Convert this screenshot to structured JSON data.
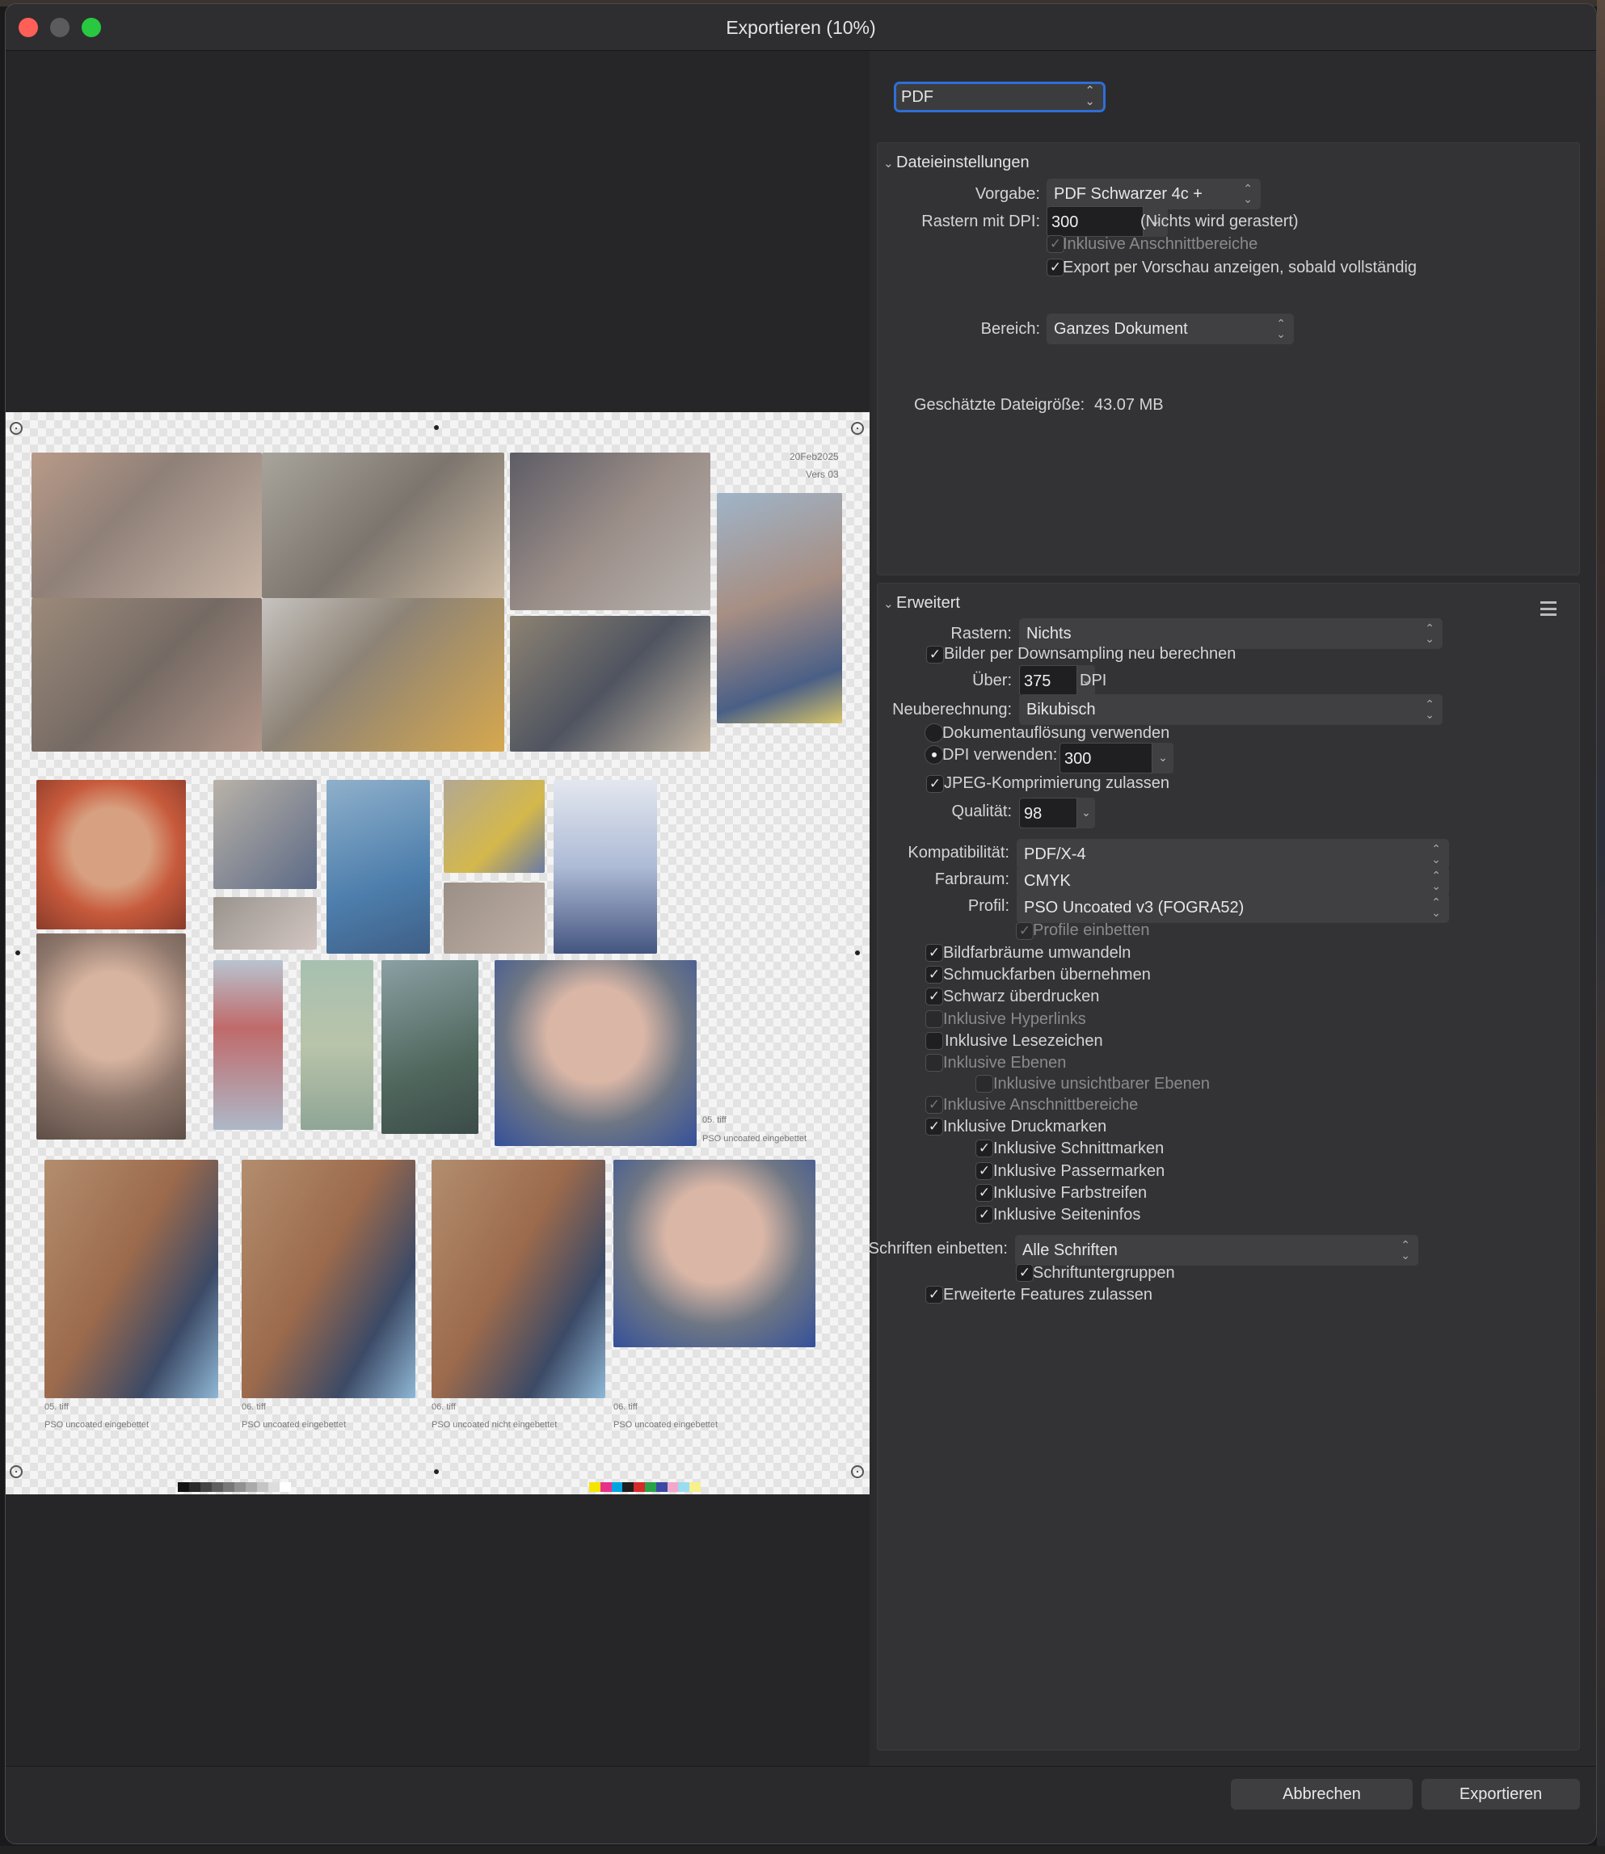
{
  "window": {
    "title": "Exportieren (10%)"
  },
  "format": {
    "selected": "PDF"
  },
  "preview": {
    "date": "20Feb2025",
    "version": "Vers 03",
    "captions": [
      "05. tiff",
      "PSO uncoated eingebettet",
      "05. tiff",
      "PSO uncoated eingebettet",
      "06. tiff",
      "PSO uncoated eingebettet",
      "06. tiff",
      "PSO uncoated nicht eingebettet",
      "06. tiff",
      "PSO uncoated eingebettet"
    ]
  },
  "file_settings": {
    "title": "Dateieinstellungen",
    "preset_label": "Vorgabe:",
    "preset_value": "PDF Schwarzer 4c +",
    "raster_dpi_label": "Rastern mit DPI:",
    "raster_dpi_value": "300",
    "raster_note": "(Nichts wird gerastert)",
    "include_bleed": "Inklusive Anschnittbereiche",
    "preview_after": "Export per Vorschau anzeigen, sobald vollständig",
    "area_label": "Bereich:",
    "area_value": "Ganzes Dokument",
    "size_label": "Geschätzte Dateigröße:",
    "size_value": "43.07 MB"
  },
  "advanced": {
    "title": "Erweitert",
    "raster_label": "Rastern:",
    "raster_value": "Nichts",
    "downsample": "Bilder per Downsampling neu berechnen",
    "over_label": "Über:",
    "over_value": "375",
    "dpi_unit": "DPI",
    "resample_label": "Neuberechnung:",
    "resample_value": "Bikubisch",
    "use_doc_res": "Dokumentauflösung verwenden",
    "use_dpi": "DPI verwenden:",
    "use_dpi_value": "300",
    "jpeg": "JPEG-Komprimierung zulassen",
    "quality_label": "Qualität:",
    "quality_value": "98",
    "compat_label": "Kompatibilität:",
    "compat_value": "PDF/X-4",
    "colorspace_label": "Farbraum:",
    "colorspace_value": "CMYK",
    "profile_label": "Profil:",
    "profile_value": "PSO Uncoated v3 (FOGRA52)",
    "embed_profile": "Profile einbetten",
    "convert_image_spaces": "Bildfarbräume umwandeln",
    "spot_colors": "Schmuckfarben übernehmen",
    "overprint_black": "Schwarz überdrucken",
    "hyperlinks": "Inklusive Hyperlinks",
    "bookmarks": "Inklusive Lesezeichen",
    "layers": "Inklusive Ebenen",
    "hidden_layers": "Inklusive unsichtbarer Ebenen",
    "bleed": "Inklusive Anschnittbereiche",
    "printer_marks": "Inklusive Druckmarken",
    "crop_marks": "Inklusive Schnittmarken",
    "registration_marks": "Inklusive Passermarken",
    "color_bars": "Inklusive Farbstreifen",
    "page_info": "Inklusive Seiteninfos",
    "fonts_label": "Schriften einbetten:",
    "fonts_value": "Alle Schriften",
    "font_subsets": "Schriftuntergruppen",
    "advanced_features": "Erweiterte Features zulassen"
  },
  "buttons": {
    "cancel": "Abbrechen",
    "export": "Exportieren"
  },
  "colors": {
    "accent": "#2e6fd6",
    "close": "#fe5f57",
    "maximize": "#28c840"
  }
}
